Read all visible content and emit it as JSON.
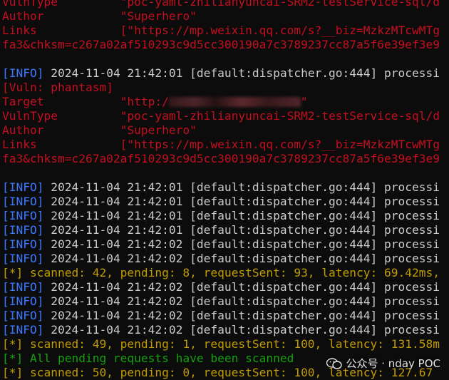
{
  "terminal": {
    "lines": [
      {
        "segments": [
          {
            "text": "VulnType         \"poc-yaml-zhilianyuncai-SRM2-testService-sql/d",
            "color": "red"
          }
        ]
      },
      {
        "segments": [
          {
            "text": "Author           \"Superhero\"",
            "color": "red"
          }
        ]
      },
      {
        "segments": [
          {
            "text": "Links            [\"https://mp.weixin.qq.com/s?__biz=MzkzMTcwMTg",
            "color": "red"
          }
        ]
      },
      {
        "segments": [
          {
            "text": "fa3&chksm=c267a02af510293c9d5cc300190a7c3789237cc87a5f6e39ef3e9",
            "color": "red"
          }
        ]
      },
      {
        "segments": []
      },
      {
        "segments": [
          {
            "text": "[INFO]",
            "color": "blue"
          },
          {
            "text": " 2024-11-04 21:42:01 [default:dispatcher.go:444] processi",
            "color": "gray"
          }
        ]
      },
      {
        "segments": [
          {
            "text": "[Vuln: phantasm]",
            "color": "red"
          }
        ]
      },
      {
        "segments": [
          {
            "text": "Target           \"http:/",
            "color": "red"
          },
          {
            "blur": true
          },
          {
            "text": "\"",
            "color": "red"
          }
        ]
      },
      {
        "segments": [
          {
            "text": "VulnType         \"poc-yaml-zhilianyuncai-SRM2-testService-sql/d",
            "color": "red"
          }
        ]
      },
      {
        "segments": [
          {
            "text": "Author           \"Superhero\"",
            "color": "red"
          }
        ]
      },
      {
        "segments": [
          {
            "text": "Links            [\"https://mp.weixin.qq.com/s?__biz=MzkzMTcwMTg",
            "color": "red"
          }
        ]
      },
      {
        "segments": [
          {
            "text": "fa3&chksm=c267a02af510293c9d5cc300190a7c3789237cc87a5f6e39ef3e9",
            "color": "red"
          }
        ]
      },
      {
        "segments": []
      },
      {
        "segments": [
          {
            "text": "[INFO]",
            "color": "blue"
          },
          {
            "text": " 2024-11-04 21:42:01 [default:dispatcher.go:444] processi",
            "color": "gray"
          }
        ]
      },
      {
        "segments": [
          {
            "text": "[INFO]",
            "color": "blue"
          },
          {
            "text": " 2024-11-04 21:42:01 [default:dispatcher.go:444] processi",
            "color": "gray"
          }
        ]
      },
      {
        "segments": [
          {
            "text": "[INFO]",
            "color": "blue"
          },
          {
            "text": " 2024-11-04 21:42:01 [default:dispatcher.go:444] processi",
            "color": "gray"
          }
        ]
      },
      {
        "segments": [
          {
            "text": "[INFO]",
            "color": "blue"
          },
          {
            "text": " 2024-11-04 21:42:01 [default:dispatcher.go:444] processi",
            "color": "gray"
          }
        ]
      },
      {
        "segments": [
          {
            "text": "[INFO]",
            "color": "blue"
          },
          {
            "text": " 2024-11-04 21:42:02 [default:dispatcher.go:444] processi",
            "color": "gray"
          }
        ]
      },
      {
        "segments": [
          {
            "text": "[INFO]",
            "color": "blue"
          },
          {
            "text": " 2024-11-04 21:42:02 [default:dispatcher.go:444] processi",
            "color": "gray"
          }
        ]
      },
      {
        "segments": [
          {
            "text": "[*] scanned: 42, pending: 8, requestSent: 93, latency: 69.42ms,",
            "color": "yellow"
          }
        ]
      },
      {
        "segments": [
          {
            "text": "[INFO]",
            "color": "blue"
          },
          {
            "text": " 2024-11-04 21:42:02 [default:dispatcher.go:444] processi",
            "color": "gray"
          }
        ]
      },
      {
        "segments": [
          {
            "text": "[INFO]",
            "color": "blue"
          },
          {
            "text": " 2024-11-04 21:42:02 [default:dispatcher.go:444] processi",
            "color": "gray"
          }
        ]
      },
      {
        "segments": [
          {
            "text": "[INFO]",
            "color": "blue"
          },
          {
            "text": " 2024-11-04 21:42:02 [default:dispatcher.go:444] processi",
            "color": "gray"
          }
        ]
      },
      {
        "segments": [
          {
            "text": "[INFO]",
            "color": "blue"
          },
          {
            "text": " 2024-11-04 21:42:02 [default:dispatcher.go:444] processi",
            "color": "gray"
          }
        ]
      },
      {
        "segments": [
          {
            "text": "[*] scanned: 49, pending: 1, requestSent: 100, latency: 131.58m",
            "color": "yellow"
          }
        ]
      },
      {
        "segments": [
          {
            "text": "[*] All pending requests have been scanned",
            "color": "green"
          }
        ]
      },
      {
        "segments": [
          {
            "text": "[*] scanned: 50, pending: 0, requestSent: 100, latency: 127.67",
            "color": "yellow"
          }
        ]
      }
    ]
  },
  "watermark": {
    "text": "公众号 · nday POC",
    "icon": "wechat-icon"
  }
}
